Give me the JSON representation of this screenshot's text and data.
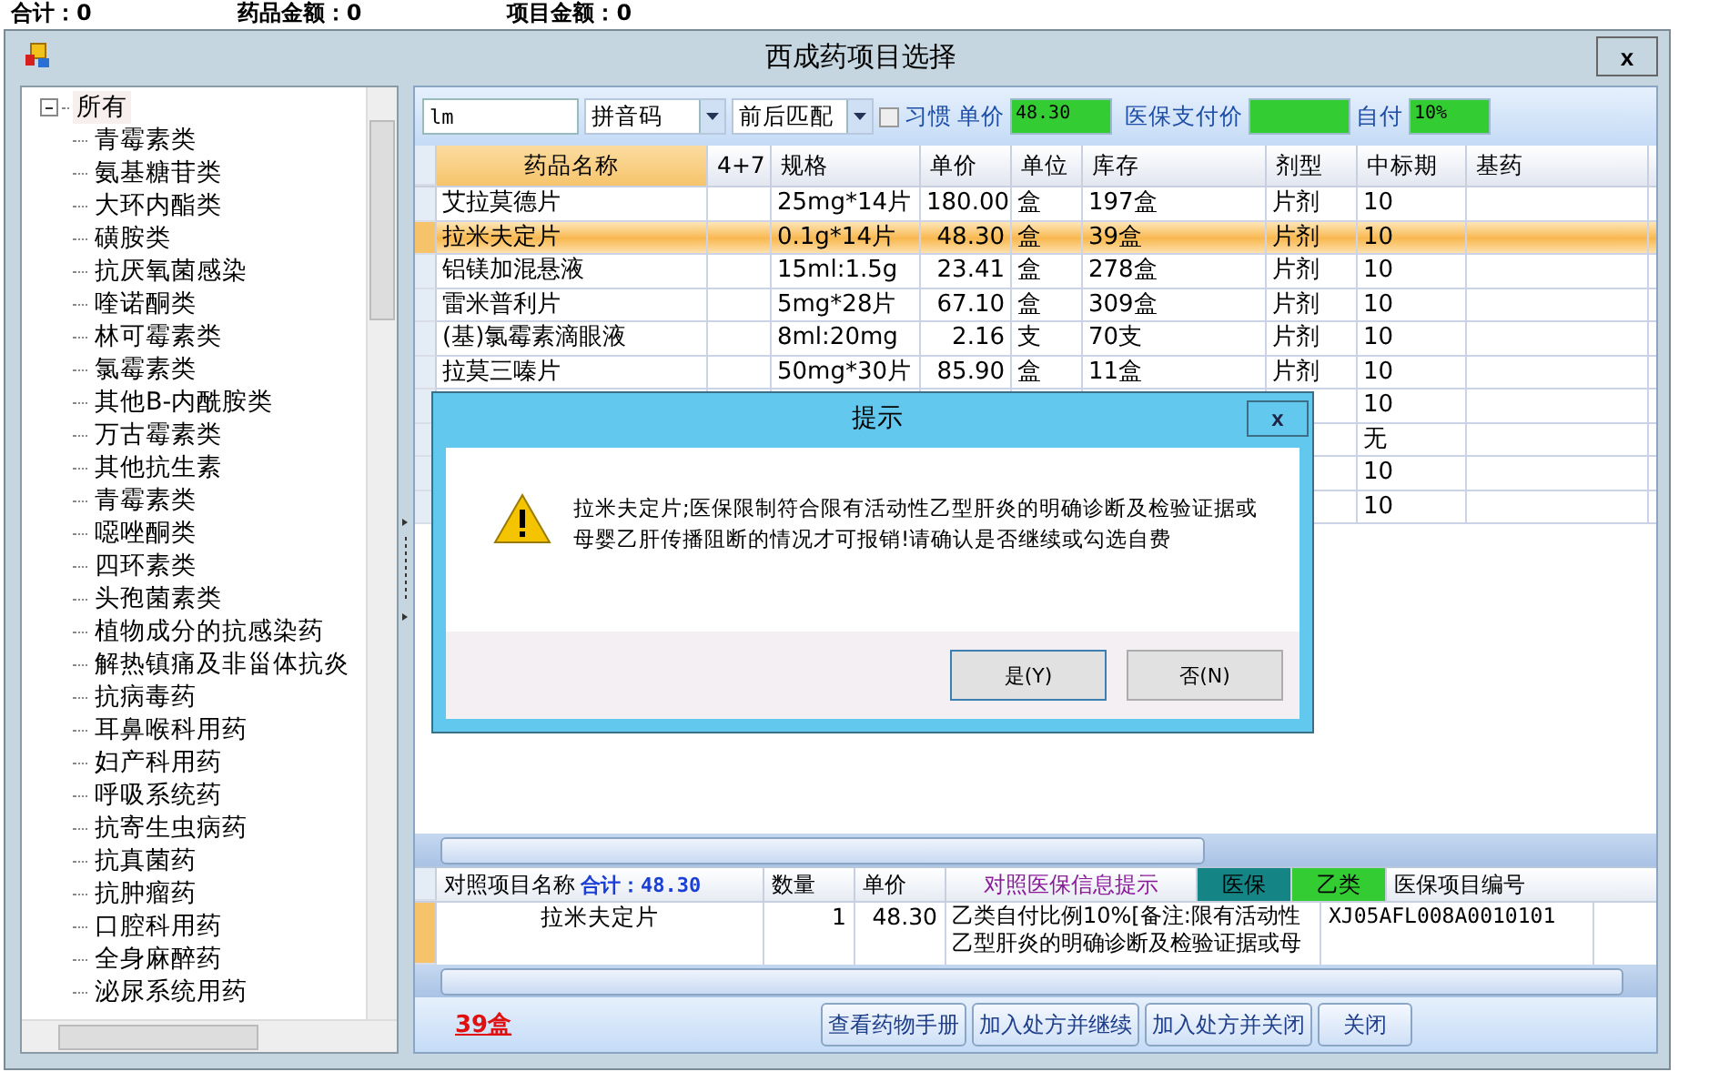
{
  "background_labels": [
    "合计：0",
    "药品金额：0",
    "项目金额：0"
  ],
  "window": {
    "title": "西成药项目选择",
    "close": "x"
  },
  "tree": {
    "root": {
      "label": "所有",
      "selected": true,
      "expanded": true,
      "children": [
        {
          "label": "青霉素类",
          "selected": false
        },
        {
          "label": "氨基糖苷类",
          "selected": false
        },
        {
          "label": "大环内酯类",
          "selected": false
        },
        {
          "label": "磺胺类",
          "selected": false
        },
        {
          "label": "抗厌氧菌感染",
          "selected": false
        },
        {
          "label": "喹诺酮类",
          "selected": false
        },
        {
          "label": "林可霉素类",
          "selected": false
        },
        {
          "label": "氯霉素类",
          "selected": false
        },
        {
          "label": "其他B-内酰胺类",
          "selected": false
        },
        {
          "label": "万古霉素类",
          "selected": false
        },
        {
          "label": "其他抗生素",
          "selected": false
        },
        {
          "label": "青霉素类",
          "selected": false
        },
        {
          "label": "噁唑酮类",
          "selected": false
        },
        {
          "label": "四环素类",
          "selected": false
        },
        {
          "label": "头孢菌素类",
          "selected": false
        },
        {
          "label": "植物成分的抗感染药",
          "selected": false
        },
        {
          "label": "解热镇痛及非甾体抗炎",
          "selected": false
        },
        {
          "label": "抗病毒药",
          "selected": false
        },
        {
          "label": "耳鼻喉科用药",
          "selected": false
        },
        {
          "label": "妇产科用药",
          "selected": false
        },
        {
          "label": "呼吸系统药",
          "selected": false
        },
        {
          "label": "抗寄生虫病药",
          "selected": false
        },
        {
          "label": "抗真菌药",
          "selected": false
        },
        {
          "label": "抗肿瘤药",
          "selected": false
        },
        {
          "label": "口腔科用药",
          "selected": false
        },
        {
          "label": "全身麻醉药",
          "selected": false
        },
        {
          "label": "泌尿系统用药",
          "selected": false
        }
      ]
    }
  },
  "toolbar": {
    "search": "lm",
    "code_type": "拼音码",
    "match_mode": "前后匹配",
    "habit": {
      "label": "习惯",
      "checked": false
    },
    "price_label": "单价",
    "price": "48.30",
    "insurance_price_label": "医保支付价",
    "self_pay_label": "自付",
    "self_pay": "10%"
  },
  "table": {
    "columns": [
      "药品名称",
      "4+7",
      "规格",
      "单价",
      "单位",
      "库存",
      "剂型",
      "中标期",
      "基药"
    ],
    "rows": [
      {
        "selected": false,
        "cells": [
          "艾拉莫德片",
          "",
          "25mg*14片",
          "180.00",
          "盒",
          "197盒",
          "片剂",
          "10",
          ""
        ]
      },
      {
        "selected": true,
        "cells": [
          "拉米夫定片",
          "",
          "0.1g*14片",
          "48.30",
          "盒",
          "39盒",
          "片剂",
          "10",
          ""
        ]
      },
      {
        "selected": false,
        "cells": [
          "铝镁加混悬液",
          "",
          "15ml:1.5g",
          "23.41",
          "盒",
          "278盒",
          "片剂",
          "10",
          ""
        ]
      },
      {
        "selected": false,
        "cells": [
          "雷米普利片",
          "",
          "5mg*28片",
          "67.10",
          "盒",
          "309盒",
          "片剂",
          "10",
          ""
        ]
      },
      {
        "selected": false,
        "cells": [
          "(基)氯霉素滴眼液",
          "",
          "8ml:20mg",
          "2.16",
          "支",
          "70支",
          "片剂",
          "10",
          ""
        ]
      },
      {
        "selected": false,
        "cells": [
          "拉莫三嗪片",
          "",
          "50mg*30片",
          "85.90",
          "盒",
          "11盒",
          "片剂",
          "10",
          ""
        ]
      },
      {
        "selected": false,
        "cells": [
          "",
          "",
          "",
          "",
          "",
          "",
          "",
          "10",
          ""
        ]
      },
      {
        "selected": false,
        "cells": [
          "",
          "",
          "",
          "",
          "",
          "",
          "",
          "无",
          ""
        ]
      },
      {
        "selected": false,
        "cells": [
          "",
          "",
          "",
          "",
          "",
          "",
          "",
          "10",
          ""
        ]
      },
      {
        "selected": false,
        "cells": [
          "",
          "",
          "",
          "",
          "",
          "",
          "",
          "10",
          ""
        ]
      }
    ]
  },
  "detail": {
    "columns": {
      "name": "对照项目名称",
      "total": "合计：48.30",
      "qty": "数量",
      "price": "单价",
      "hint": "对照医保信息提示",
      "insurance": "医保",
      "category": "乙类",
      "code": "医保项目编号"
    },
    "row": {
      "name": "拉米夫定片",
      "qty": "1",
      "price": "48.30",
      "hint_lines": [
        "乙类自付比例10%[备注:限有活动性",
        "乙型肝炎的明确诊断及检验证据或母"
      ],
      "code": "XJ05AFL008A0010101"
    }
  },
  "footer": {
    "stock": "39盒",
    "buttons": [
      "查看药物手册",
      "加入处方并继续",
      "加入处方并关闭",
      "关闭"
    ]
  },
  "dialog": {
    "title": "提示",
    "close": "x",
    "message": "拉米夫定片;医保限制符合限有活动性乙型肝炎的明确诊断及检验证据或母婴乙肝传播阻断的情况才可报销!请确认是否继续或勾选自费",
    "buttons": [
      "是(Y)",
      "否(N)"
    ]
  }
}
